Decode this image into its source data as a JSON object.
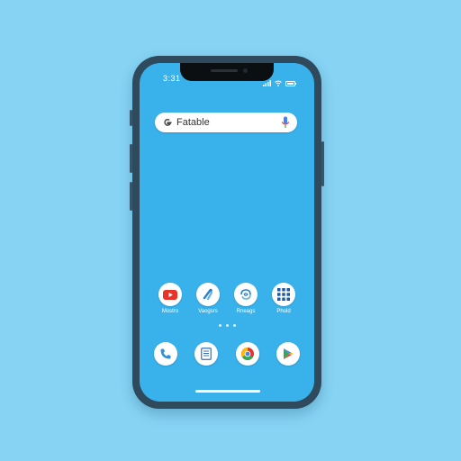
{
  "status_bar": {
    "time": "3:31",
    "icons": [
      "signal-icon",
      "wifi-icon",
      "battery-icon"
    ]
  },
  "search_bar": {
    "logo_icon": "google-g-icon",
    "text": "Fatable",
    "mic_icon": "mic-icon"
  },
  "apps": [
    {
      "label": "Mostro",
      "icon": "youtube-icon",
      "color": "#e8332b"
    },
    {
      "label": "Vaogsrs",
      "icon": "tools-icon",
      "color": "#2b7fd4"
    },
    {
      "label": "Rneags",
      "icon": "swirl-icon",
      "color": "#2b7fd4"
    },
    {
      "label": "Phold",
      "icon": "grid-icon",
      "color": "#1c5aa8"
    }
  ],
  "page_dots": 3,
  "dock": [
    {
      "icon": "phone-icon",
      "color": "#2f8fd8"
    },
    {
      "icon": "notes-icon",
      "color": "#3a6fb0"
    },
    {
      "icon": "chrome-icon",
      "color": "#e8332b"
    },
    {
      "icon": "play-store-icon",
      "color": "#34a853"
    }
  ],
  "colors": {
    "background": "#86d3f4",
    "screen": "#39b2ec",
    "frame": "#2f4a5c"
  }
}
